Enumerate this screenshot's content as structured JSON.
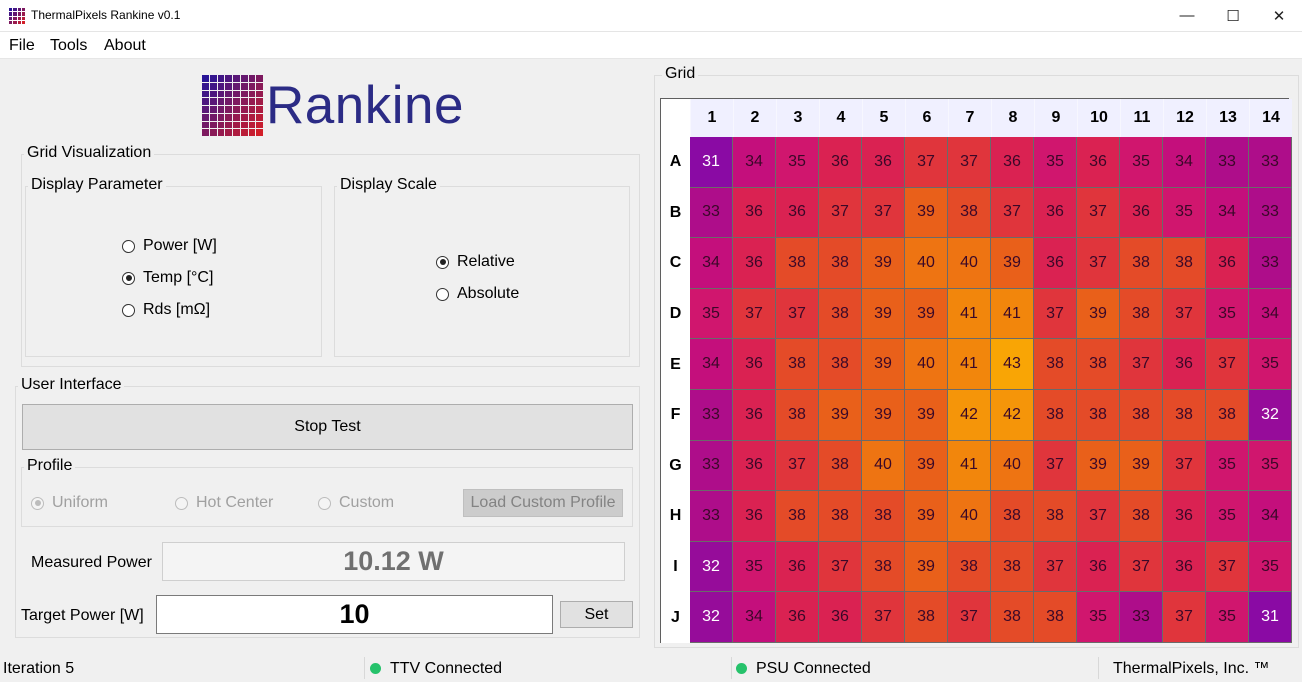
{
  "window": {
    "title": "ThermalPixels Rankine v0.1",
    "minimize": "—",
    "maximize": "☐",
    "close": "✕"
  },
  "menu": {
    "file": "File",
    "tools": "Tools",
    "about": "About"
  },
  "logo": {
    "text": "Rankine"
  },
  "grid_visualization": {
    "title": "Grid Visualization",
    "display_parameter": {
      "title": "Display Parameter",
      "options": [
        "Power [W]",
        "Temp [°C]",
        "Rds [mΩ]"
      ],
      "selected": "Temp [°C]"
    },
    "display_scale": {
      "title": "Display Scale",
      "options": [
        "Relative",
        "Absolute"
      ],
      "selected": "Relative"
    }
  },
  "user_interface": {
    "title": "User Interface",
    "stop_button": "Stop Test",
    "profile": {
      "title": "Profile",
      "options": [
        "Uniform",
        "Hot Center",
        "Custom"
      ],
      "selected": "Uniform",
      "load_button": "Load Custom Profile"
    },
    "measured_power_label": "Measured Power",
    "measured_power_value": "10.12 W",
    "target_power_label": "Target Power [W]",
    "target_power_value": "10",
    "set_button": "Set"
  },
  "grid": {
    "title": "Grid",
    "columns": [
      "1",
      "2",
      "3",
      "4",
      "5",
      "6",
      "7",
      "8",
      "9",
      "10",
      "11",
      "12",
      "13",
      "14"
    ],
    "rows": [
      "A",
      "B",
      "C",
      "D",
      "E",
      "F",
      "G",
      "H",
      "I",
      "J"
    ],
    "values": [
      [
        31,
        34,
        35,
        36,
        36,
        37,
        37,
        36,
        35,
        36,
        35,
        34,
        33,
        33
      ],
      [
        33,
        36,
        36,
        37,
        37,
        39,
        38,
        37,
        36,
        37,
        36,
        35,
        34,
        33
      ],
      [
        34,
        36,
        38,
        38,
        39,
        40,
        40,
        39,
        36,
        37,
        38,
        38,
        36,
        33
      ],
      [
        35,
        37,
        37,
        38,
        39,
        39,
        41,
        41,
        37,
        39,
        38,
        37,
        35,
        34
      ],
      [
        34,
        36,
        38,
        38,
        39,
        40,
        41,
        43,
        38,
        38,
        37,
        36,
        37,
        35
      ],
      [
        33,
        36,
        38,
        39,
        39,
        39,
        42,
        42,
        38,
        38,
        38,
        38,
        38,
        32
      ],
      [
        33,
        36,
        37,
        38,
        40,
        39,
        41,
        40,
        37,
        39,
        39,
        37,
        35,
        35
      ],
      [
        33,
        36,
        38,
        38,
        38,
        39,
        40,
        38,
        38,
        37,
        38,
        36,
        35,
        34
      ],
      [
        32,
        35,
        36,
        37,
        38,
        39,
        38,
        38,
        37,
        36,
        37,
        36,
        37,
        35
      ],
      [
        32,
        34,
        36,
        36,
        37,
        38,
        37,
        38,
        38,
        35,
        33,
        37,
        35,
        31
      ]
    ],
    "color_scale": {
      "31": "#8a0aa4",
      "32": "#960c9a",
      "33": "#ae0d8a",
      "34": "#c40f7c",
      "35": "#d0166e",
      "36": "#da2252",
      "37": "#e0353c",
      "38": "#e44b28",
      "39": "#e9601a",
      "40": "#ee7412",
      "41": "#f2860c",
      "42": "#f59509",
      "43": "#f9a505"
    },
    "light_text_values": [
      31,
      32
    ]
  },
  "status": {
    "iteration": "Iteration 5",
    "ttv": "TTV Connected",
    "psu": "PSU Connected",
    "company": "ThermalPixels, Inc. ™",
    "connected_color": "#26c26b"
  }
}
